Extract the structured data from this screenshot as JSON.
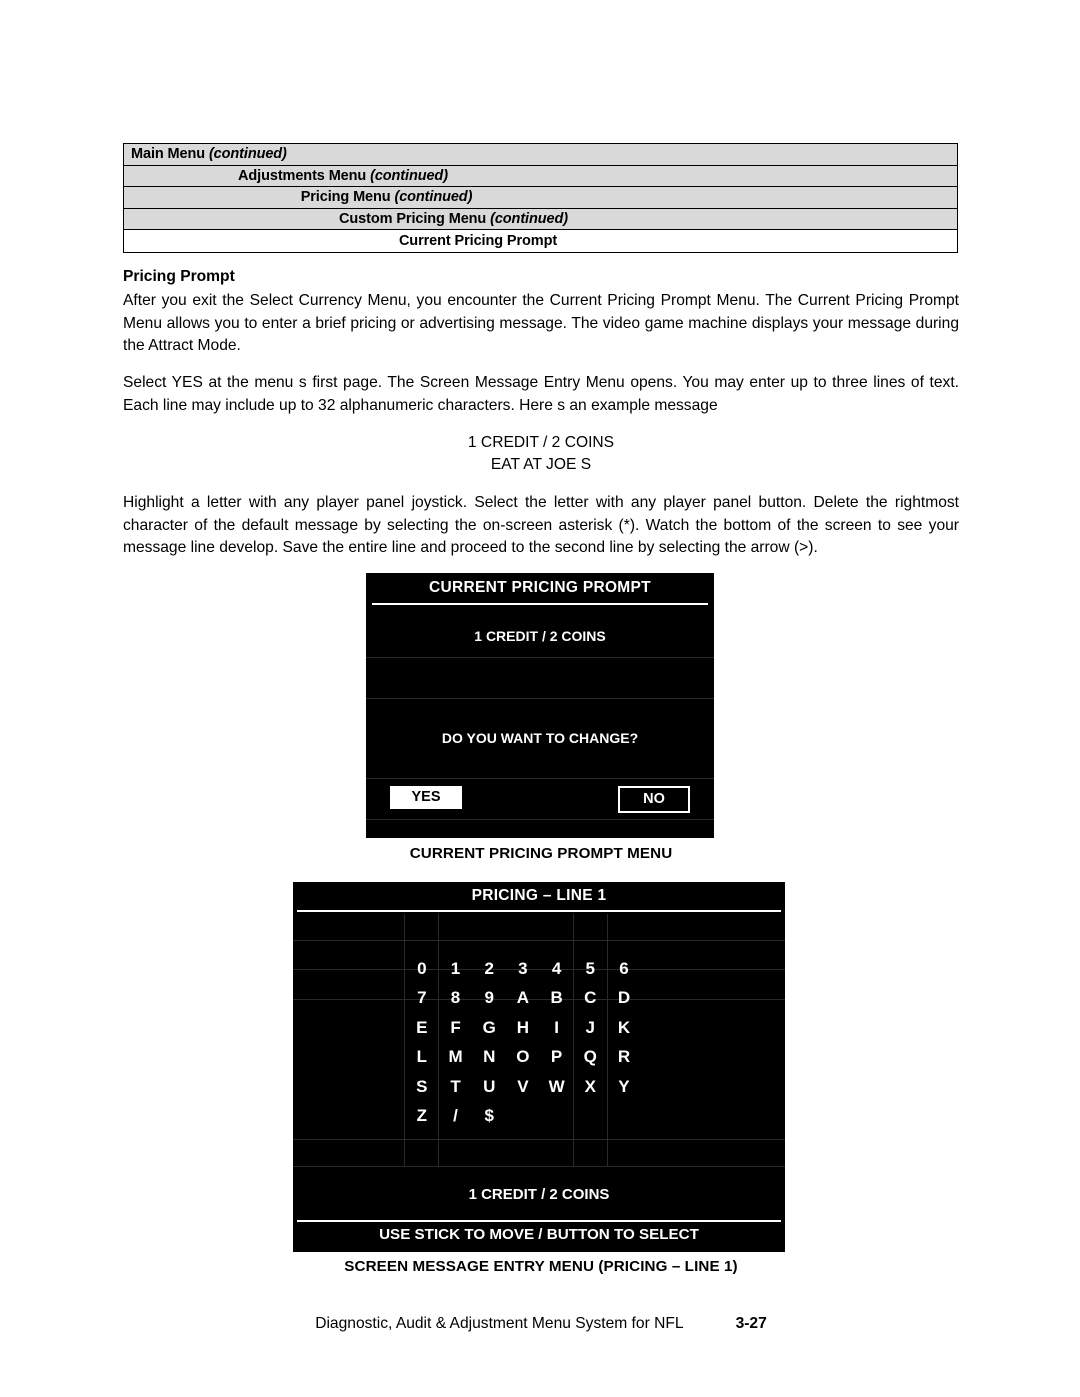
{
  "breadcrumb": {
    "rows": [
      {
        "label": "Main Menu",
        "note": "(continued)"
      },
      {
        "label": "Adjustments Menu",
        "note": "(continued)"
      },
      {
        "label": "Pricing Menu",
        "note": "(continued)"
      },
      {
        "label": "Custom Pricing Menu",
        "note": "(continued)"
      },
      {
        "label": "Current Pricing Prompt",
        "note": ""
      }
    ]
  },
  "section": {
    "heading": "Pricing Prompt",
    "para1": "After you exit the Select Currency Menu, you encounter the Current Pricing Prompt Menu. The Current Pricing Prompt Menu allows you to enter a brief pricing or advertising message. The video game machine displays your message during the Attract Mode.",
    "para2": "Select YES at the menu s first page. The Screen Message Entry Menu opens. You may enter up to three lines of text. Each line may include up to 32 alphanumeric characters. Here s an example message",
    "example_line1": "1 CREDIT / 2 COINS",
    "example_line2": "EAT AT JOE S",
    "para3": "Highlight a letter with any player panel joystick. Select the letter with any player panel button. Delete the rightmost character of the default message by selecting the on-screen asterisk (*). Watch the bottom of the screen to see your message line develop. Save the entire line and proceed to the second line by selecting the arrow (>)."
  },
  "screen1": {
    "title": "CURRENT PRICING PROMPT",
    "price_line": "1 CREDIT / 2 COINS",
    "question": "DO YOU WANT TO CHANGE?",
    "yes_label": "YES",
    "no_label": "NO",
    "caption": "CURRENT PRICING PROMPT MENU"
  },
  "screen2": {
    "title": "PRICING – LINE 1",
    "char_rows": [
      [
        "0",
        "1",
        "2",
        "3",
        "4",
        "5",
        "6"
      ],
      [
        "7",
        "8",
        "9",
        "A",
        "B",
        "C",
        "D"
      ],
      [
        "E",
        "F",
        "G",
        "H",
        "I",
        "J",
        "K"
      ],
      [
        "L",
        "M",
        "N",
        "O",
        "P",
        "Q",
        "R"
      ],
      [
        "S",
        "T",
        "U",
        "V",
        "W",
        "X",
        "Y"
      ],
      [
        "Z",
        "/",
        "$",
        "",
        "",
        "",
        ""
      ]
    ],
    "message_line": "1 CREDIT / 2 COINS",
    "footer": "USE STICK TO MOVE / BUTTON TO SELECT",
    "caption": "SCREEN MESSAGE ENTRY MENU (PRICING – LINE 1)"
  },
  "footer": {
    "label": "Diagnostic, Audit & Adjustment Menu System for NFL",
    "page_number": "3-27"
  },
  "colors": {
    "screen_background": "#000000",
    "screen_text": "#ffffff",
    "breadcrumb_fill": "#d9d9d9",
    "breadcrumb_last_fill": "#ffffff",
    "page_background": "#ffffff"
  }
}
